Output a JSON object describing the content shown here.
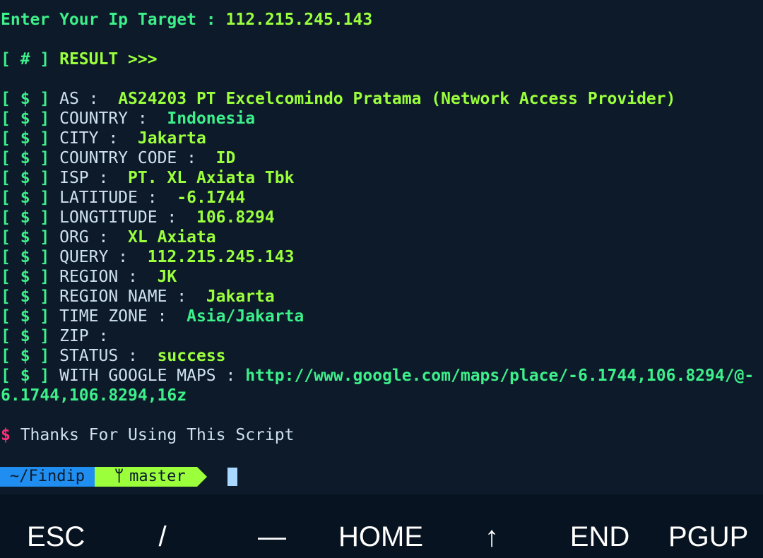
{
  "prompt_input": {
    "label": "Enter Your Ip Target : ",
    "value": "112.215.245.143"
  },
  "result_header": {
    "prefix": "[ # ] ",
    "text": "RESULT >>>"
  },
  "row_prefix": "[ $ ] ",
  "rows": [
    {
      "label": "AS :  ",
      "value": "AS24203 PT Excelcomindo Pratama (Network Access Provider)"
    },
    {
      "label": "COUNTRY :  ",
      "value": "Indonesia"
    },
    {
      "label": "CITY :  ",
      "value": "Jakarta"
    },
    {
      "label": "COUNTRY CODE :  ",
      "value": "ID"
    },
    {
      "label": "ISP :  ",
      "value": "PT. XL Axiata Tbk"
    },
    {
      "label": "LATITUDE :  ",
      "value": "-6.1744"
    },
    {
      "label": "LONGTITUDE :  ",
      "value": "106.8294"
    },
    {
      "label": "ORG :  ",
      "value": "XL Axiata"
    },
    {
      "label": "QUERY :  ",
      "value": "112.215.245.143"
    },
    {
      "label": "REGION :  ",
      "value": "JK"
    },
    {
      "label": "REGION NAME :  ",
      "value": "Jakarta"
    },
    {
      "label": "TIME ZONE :  ",
      "value": "Asia/Jakarta"
    },
    {
      "label": "ZIP :  ",
      "value": ""
    },
    {
      "label": "STATUS :  ",
      "value": "success"
    },
    {
      "label": "WITH GOOGLE MAPS : ",
      "value": "http://www.google.com/maps/place/-6.1744,106.8294/@-"
    }
  ],
  "maps_continuation": "6.1744,106.8294,16z",
  "thanks": {
    "symbol": "$",
    "text": " Thanks For Using This Script"
  },
  "prompt_bar": {
    "directory": "~/Findip",
    "branch_icon": "git-branch-icon",
    "branch_glyph": "ᛘ",
    "branch": "master"
  },
  "colors": {
    "background": "#0c1a2a",
    "green": "#9bff3c",
    "teal": "#3df08a",
    "pink": "#ff2f7a",
    "directory_segment": "#1f8ef0"
  },
  "extra_keys": [
    "ESC",
    "/",
    "—",
    "HOME",
    "↑",
    "END",
    "PGUP"
  ]
}
